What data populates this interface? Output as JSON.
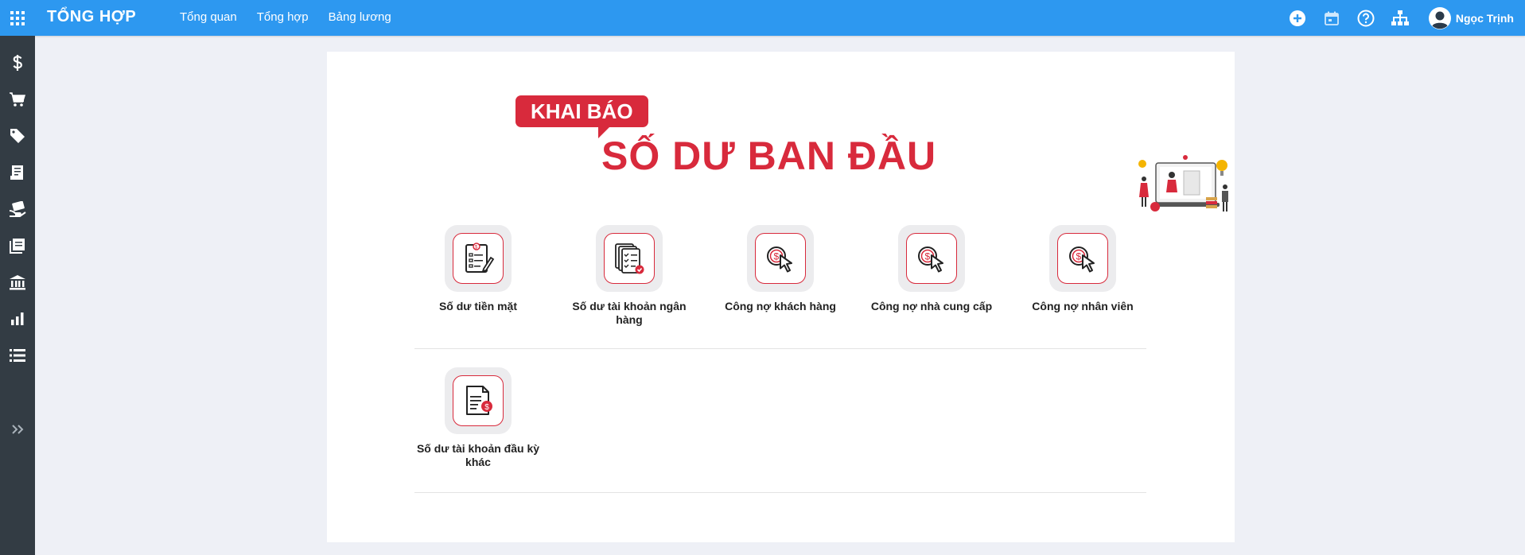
{
  "app": {
    "title": "TỔNG HỢP"
  },
  "nav": [
    {
      "label": "Tổng quan"
    },
    {
      "label": "Tổng hợp"
    },
    {
      "label": "Bảng lương"
    }
  ],
  "header_icons": [
    "plus-circle-icon",
    "calendar-icon",
    "help-icon",
    "org-chart-icon"
  ],
  "user": {
    "name": "Ngọc Trịnh"
  },
  "sidebar": [
    {
      "icon": "dollar-icon"
    },
    {
      "icon": "cart-icon"
    },
    {
      "icon": "tag-icon"
    },
    {
      "icon": "receipt-icon"
    },
    {
      "icon": "hand-money-icon"
    },
    {
      "icon": "book-icon"
    },
    {
      "icon": "bank-icon"
    },
    {
      "icon": "bar-chart-icon"
    },
    {
      "icon": "list-icon"
    },
    {
      "icon": "expand-icon"
    }
  ],
  "banner": {
    "bubble": "KHAI BÁO",
    "title": "SỐ DƯ BAN ĐẦU"
  },
  "tiles": [
    {
      "label": "Số dư tiền mặt",
      "icon": "cash-document-icon"
    },
    {
      "label": "Số dư tài khoản ngân hàng",
      "icon": "bank-documents-icon"
    },
    {
      "label": "Công nợ khách hàng",
      "icon": "coin-cursor-icon"
    },
    {
      "label": "Công nợ nhà cung cấp",
      "icon": "coin-cursor-icon"
    },
    {
      "label": "Công nợ nhân viên",
      "icon": "coin-cursor-icon"
    },
    {
      "label": "Số dư tài khoản đầu kỳ khác",
      "icon": "document-coin-icon"
    }
  ],
  "colors": {
    "header": "#2d98f0",
    "sidebar": "#333c44",
    "accent": "#d82a3c",
    "page": "#eef0f6"
  }
}
